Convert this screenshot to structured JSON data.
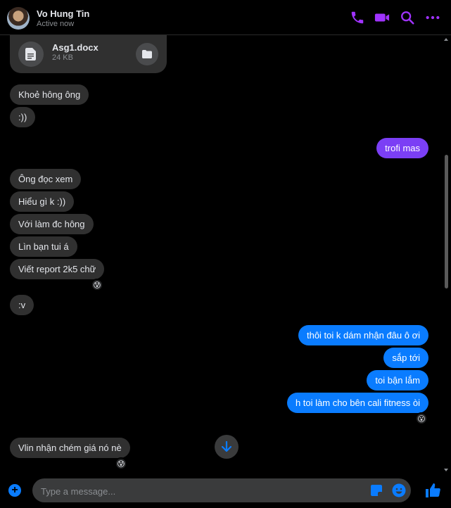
{
  "header": {
    "name": "Vo Hung Tin",
    "status": "Active now"
  },
  "file": {
    "name": "Asg1.docx",
    "size": "24 KB"
  },
  "messages": [
    {
      "text": "Khoẻ hông ông",
      "from": "them"
    },
    {
      "text": ":))",
      "from": "them"
    },
    {
      "text": "trofi mas",
      "from": "me"
    },
    {
      "text": "Ông đọc xem",
      "from": "them"
    },
    {
      "text": "Hiểu gì k :))",
      "from": "them"
    },
    {
      "text": "Với làm đc hông",
      "from": "them"
    },
    {
      "text": "Lìn bạn tui á",
      "from": "them"
    },
    {
      "text": "Viết report 2k5 chữ",
      "from": "them",
      "reaction": "😰"
    },
    {
      "text": ":v",
      "from": "them"
    },
    {
      "text": "thôi toi k dám nhận đâu ô ơi",
      "from": "me"
    },
    {
      "text": "sắp tới",
      "from": "me"
    },
    {
      "text": "toi bận lắm",
      "from": "me"
    },
    {
      "text": "h toi làm cho bên cali fitness òi",
      "from": "me",
      "reaction": "😮"
    },
    {
      "text": "Vlin nhận chém giá nó nè",
      "from": "them",
      "reaction": "😰"
    }
  ],
  "composer": {
    "placeholder": "Type a message..."
  },
  "colors": {
    "accent": "#a033ff",
    "outgoing": "#0a7cff",
    "outgoing_first": "#7b3ff5",
    "incoming": "#303030"
  }
}
